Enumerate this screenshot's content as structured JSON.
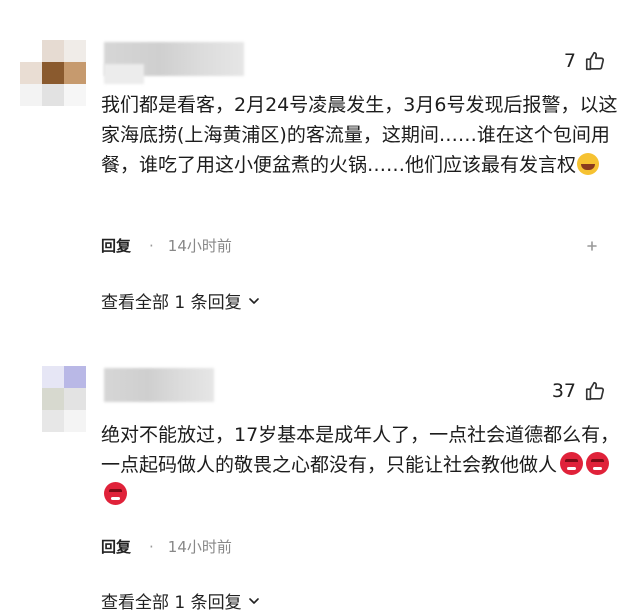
{
  "comments": [
    {
      "likes": "7",
      "text": "我们都是看客，2月24号凌晨发生，3月6号发现后报警，以这家海底捞(上海黄浦区)的客流量，这期间……谁在这个包间用餐，谁吃了用这小便盆煮的火锅……他们应该最有发言权",
      "emoji": "laughing-crying-emoji",
      "reply_label": "回复",
      "separator": "·",
      "time": "14小时前",
      "view_replies": "查看全部 1 条回复"
    },
    {
      "likes": "37",
      "text": "绝对不能放过，17岁基本是成年人了，一点社会道德都么有，一点起码做人的敬畏之心都没有，只能让社会教他做人",
      "emoji": "angry-face-emoji",
      "reply_label": "回复",
      "separator": "·",
      "time": "14小时前",
      "view_replies": "查看全部 1 条回复"
    }
  ],
  "colors": {
    "text": "#1c1c1c",
    "muted": "#888888",
    "avatar1": [
      "#ffffff",
      "#e9ddd3",
      "#8a5a2e",
      "#c69a6e",
      "#e2e2e2",
      "#f3f3f3"
    ],
    "avatar2": [
      "#e6e6f5",
      "#b9b8e6",
      "#ffffff",
      "#d7d9cf",
      "#e7e7e7",
      "#ffffff"
    ]
  }
}
